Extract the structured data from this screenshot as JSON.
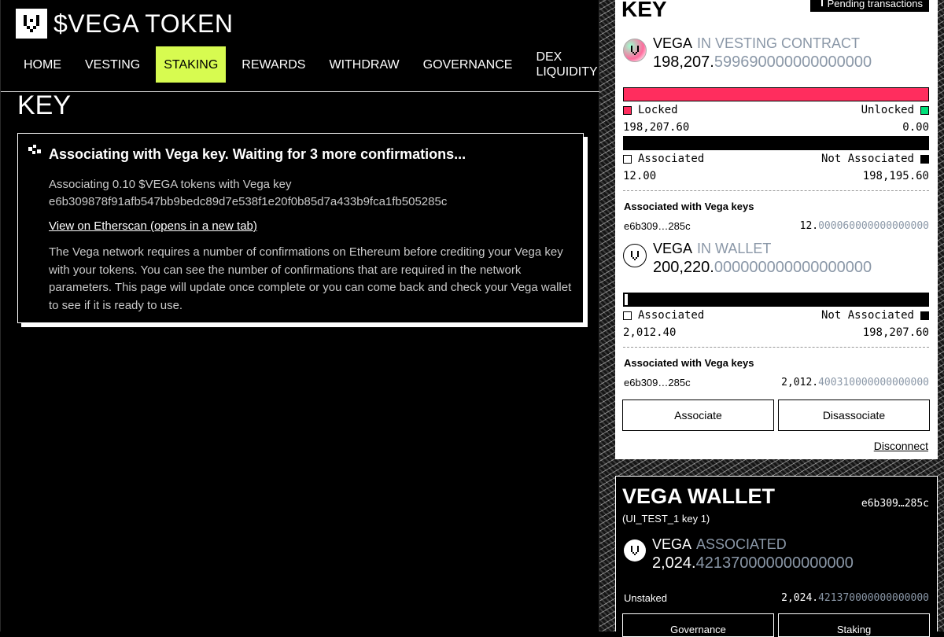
{
  "app": {
    "title": "$VEGA TOKEN",
    "nav": [
      {
        "label": "HOME"
      },
      {
        "label": "VESTING"
      },
      {
        "label": "STAKING",
        "active": true
      },
      {
        "label": "REWARDS"
      },
      {
        "label": "WITHDRAW"
      },
      {
        "label": "GOVERNANCE"
      },
      {
        "label_line1": "DEX",
        "label_line2": "LIQUIDITY"
      }
    ],
    "accent_color": "#d7fb50"
  },
  "main": {
    "heading": "KEY",
    "confirmation": {
      "title": "Associating with Vega key. Waiting for 3 more confirmations...",
      "desc_line1": "Associating 0.10 $VEGA tokens with Vega key",
      "desc_line2": "e6b309878f91afb547bb9bedc89d7e538f1e20f0b85d7a433b9fca1fb505285c",
      "link": "View on Etherscan (opens in a new tab)",
      "note": "The Vega network requires a number of confirmations on Ethereum before crediting your Vega key with your tokens. You can see the number of confirmations that are required in the network parameters. This page will update once complete or you can come back and check your Vega wallet to see if it is ready to use."
    }
  },
  "key_panel": {
    "heading": "KEY",
    "pending_label": "Pending transactions",
    "vesting": {
      "token": "VEGA",
      "label": "IN VESTING CONTRACT",
      "amount_int": "198,207.",
      "amount_dec": "599690000000000000",
      "locked_label": "Locked",
      "unlocked_label": "Unlocked",
      "locked_value": "198,207.60",
      "unlocked_value": "0.00",
      "locked_fraction": 1.0,
      "associated_label": "Associated",
      "not_associated_label": "Not Associated",
      "associated_value": "12.00",
      "not_associated_value": "198,195.60",
      "associated_fraction": 0.0,
      "keys_title": "Associated with Vega keys",
      "key": "e6b309…285c",
      "key_amount_int": "12.",
      "key_amount_dec": "000060000000000000"
    },
    "wallet": {
      "token": "VEGA",
      "label": "IN WALLET",
      "amount_int": "200,220.",
      "amount_dec": "000000000000000000",
      "associated_label": "Associated",
      "not_associated_label": "Not Associated",
      "associated_value": "2,012.40",
      "not_associated_value": "198,207.60",
      "associated_fraction": 0.01,
      "keys_title": "Associated with Vega keys",
      "key": "e6b309…285c",
      "key_amount_int": "2,012.",
      "key_amount_dec": "400310000000000000"
    },
    "associate_btn": "Associate",
    "disassociate_btn": "Disassociate",
    "disconnect": "Disconnect",
    "colors": {
      "locked": "#ff2d5e",
      "unlocked": "#00e07a",
      "muted": "#8a97a7"
    }
  },
  "vega_wallet": {
    "title": "VEGA WALLET",
    "key_short": "e6b309…285c",
    "key_name": "(UI_TEST_1 key 1)",
    "token": "VEGA",
    "label": "ASSOCIATED",
    "amount_int": "2,024.",
    "amount_dec": "421370000000000000",
    "unstaked_label": "Unstaked",
    "unstaked_int": "2,024.",
    "unstaked_dec": "421370000000000000",
    "governance_btn": "Governance",
    "staking_btn": "Staking"
  }
}
